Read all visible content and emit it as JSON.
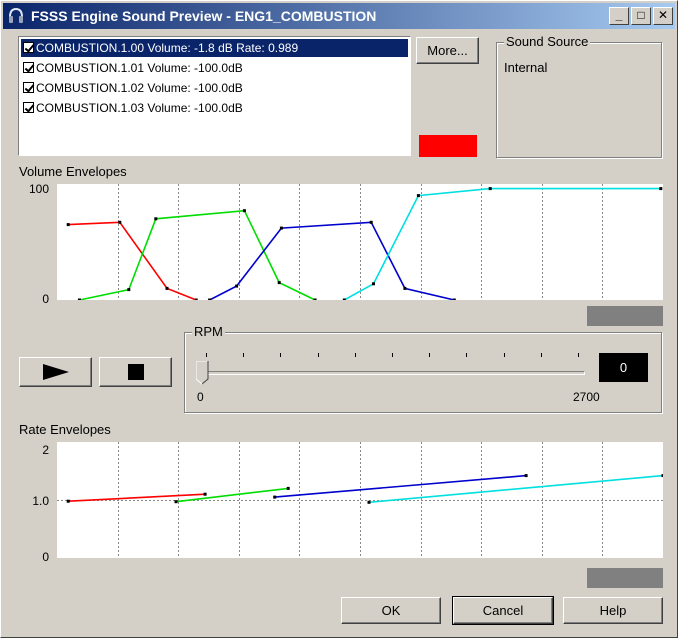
{
  "window": {
    "title": "FSSS Engine Sound Preview - ENG1_COMBUSTION",
    "minimize": "_",
    "maximize": "□",
    "close": "✕"
  },
  "sound_list": {
    "items": [
      {
        "label": "COMBUSTION.1.00 Volume: -1.8 dB  Rate: 0.989",
        "checked": true,
        "selected": true
      },
      {
        "label": "COMBUSTION.1.01 Volume: -100.0dB",
        "checked": true,
        "selected": false
      },
      {
        "label": "COMBUSTION.1.02 Volume: -100.0dB",
        "checked": true,
        "selected": false
      },
      {
        "label": "COMBUSTION.1.03 Volume: -100.0dB",
        "checked": true,
        "selected": false
      }
    ]
  },
  "more_button": "More...",
  "selected_color": "#ff0000",
  "sound_source": {
    "label": "Sound Source",
    "value": "Internal"
  },
  "volume_envelopes": {
    "label": "Volume Envelopes",
    "y_max_label": "100",
    "y_min_label": "0"
  },
  "rpm": {
    "label": "RPM",
    "min_label": "0",
    "max_label": "2700",
    "value": "0",
    "tick_count": 11,
    "position": 0
  },
  "rate_envelopes": {
    "label": "Rate Envelopes",
    "y_labels": [
      "2",
      "1.0",
      "0"
    ]
  },
  "buttons": {
    "ok": "OK",
    "cancel": "Cancel",
    "help": "Help"
  },
  "chart_data": [
    {
      "type": "line",
      "title": "Volume Envelopes",
      "xlabel": "",
      "ylabel": "",
      "ylim": [
        0,
        100
      ],
      "xlim": [
        0,
        2700
      ],
      "grid": true,
      "series": [
        {
          "color": "#ff0000",
          "x": [
            50,
            280,
            490,
            620
          ],
          "y": [
            65,
            67,
            10,
            0
          ]
        },
        {
          "color": "#00dd00",
          "x": [
            100,
            320,
            440,
            835,
            990,
            1150
          ],
          "y": [
            0,
            9,
            70,
            77,
            15,
            0
          ]
        },
        {
          "color": "#0000cc",
          "x": [
            680,
            800,
            1000,
            1400,
            1550,
            1770
          ],
          "y": [
            0,
            12,
            62,
            67,
            10,
            0
          ]
        },
        {
          "color": "#00e0e0",
          "x": [
            1280,
            1410,
            1610,
            1930,
            2690
          ],
          "y": [
            0,
            14,
            90,
            96,
            96
          ]
        }
      ]
    },
    {
      "type": "line",
      "title": "Rate Envelopes",
      "xlabel": "",
      "ylabel": "",
      "ylim": [
        0,
        2
      ],
      "xlim": [
        0,
        2700
      ],
      "grid": true,
      "series": [
        {
          "color": "#ff0000",
          "x": [
            50,
            660
          ],
          "y": [
            0.98,
            1.1
          ]
        },
        {
          "color": "#00dd00",
          "x": [
            530,
            1030
          ],
          "y": [
            0.97,
            1.2
          ]
        },
        {
          "color": "#0000cc",
          "x": [
            970,
            2090
          ],
          "y": [
            1.05,
            1.42
          ]
        },
        {
          "color": "#00e0e0",
          "x": [
            1390,
            2700
          ],
          "y": [
            0.96,
            1.42
          ]
        }
      ]
    }
  ]
}
